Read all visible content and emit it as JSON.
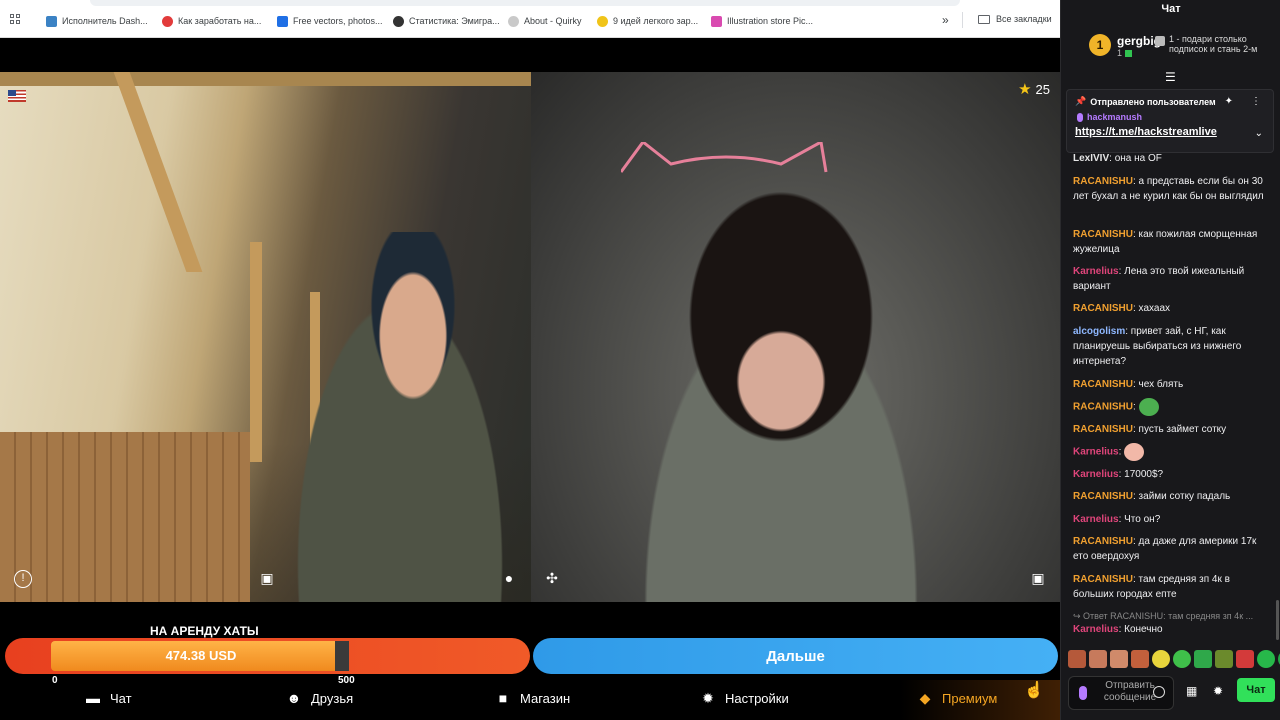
{
  "bookmarks": [
    {
      "label": "Исполнитель Dash...",
      "color": "#3b82c4"
    },
    {
      "label": "Как заработать на...",
      "color": "#e23b3b"
    },
    {
      "label": "Free vectors, photos...",
      "color": "#1f6fe5"
    },
    {
      "label": "Статистика: Эмигра...",
      "color": "#333333"
    },
    {
      "label": "About - Quirky",
      "color": "#c9c9c9"
    },
    {
      "label": "9 идей легкого зар...",
      "color": "#f0c419"
    },
    {
      "label": "Illustration store Pic...",
      "color": "#d94ab0"
    }
  ],
  "bookmarks_more": "»",
  "bookmarks_folder": "Все закладки",
  "video": {
    "rating": "25",
    "flag": "us-flag-icon"
  },
  "goal": {
    "title": "НА АРЕНДУ ХАТЫ",
    "amount": "474.38 USD",
    "min": "0",
    "max": "500",
    "progress": 0.9488
  },
  "next_button": "Дальше",
  "tabs": [
    {
      "label": "Чат",
      "icon": "chat-icon"
    },
    {
      "label": "Друзья",
      "icon": "friends-icon"
    },
    {
      "label": "Магазин",
      "icon": "shop-icon"
    },
    {
      "label": "Настройки",
      "icon": "gear-icon"
    },
    {
      "label": "Премиум",
      "icon": "premium-icon"
    }
  ],
  "chat": {
    "title": "Чат",
    "top_donor": {
      "name": "gergbig",
      "rank": "1",
      "count": "1"
    },
    "donor_hint": "1 - подари столько подписок и стань 2-м",
    "pinned": {
      "header": "Отправлено пользователем",
      "user": "hackmanush",
      "link": "https://t.me/hackstreamlive"
    },
    "messages": [
      {
        "user": "LexIVIV",
        "color": "#e6e6e6",
        "text": ": она на OF"
      },
      {
        "user": "RACANISHU",
        "color": "#f0a030",
        "text": ": а представь если бы он 30 лет бухал а не курил как бы он выглядил"
      },
      {
        "user": "RACANISHU",
        "color": "#f0a030",
        "text": ": как пожилая сморщенная жужелица"
      },
      {
        "user": "Karnelius",
        "color": "#e0457b",
        "text": ": Лена это твой ижеальный вариант"
      },
      {
        "user": "RACANISHU",
        "color": "#f0a030",
        "text": ": хахаах"
      },
      {
        "user": "alcogolism",
        "color": "#8fb8ff",
        "text": ": привет зай, с НГ, как планируешь выбираться из нижнего интернета?"
      },
      {
        "user": "RACANISHU",
        "color": "#f0a030",
        "text": ": чех блять"
      },
      {
        "user": "RACANISHU",
        "color": "#f0a030",
        "text": ":"
      },
      {
        "user": "RACANISHU",
        "color": "#f0a030",
        "text": ": пусть займет сотку"
      },
      {
        "user": "Karnelius",
        "color": "#e0457b",
        "text": ":"
      },
      {
        "user": "Karnelius",
        "color": "#e0457b",
        "text": ": 17000$?"
      },
      {
        "user": "RACANISHU",
        "color": "#f0a030",
        "text": ": займи сотку падаль"
      },
      {
        "user": "Karnelius",
        "color": "#e0457b",
        "text": ": Что он?"
      },
      {
        "user": "RACANISHU",
        "color": "#f0a030",
        "text": ": да даже для америки 17к ето овердохуя"
      },
      {
        "user": "RACANISHU",
        "color": "#f0a030",
        "text": ": там средняя зп 4к в больших городах епте"
      },
      {
        "user": "Karnelius",
        "color": "#e0457b",
        "text": ": Конечно"
      }
    ],
    "reply_hint": "Ответ RACANISHU: там средняя зп 4к ...",
    "input_placeholder": "Отправить сообщение",
    "send_label": "Чат"
  }
}
